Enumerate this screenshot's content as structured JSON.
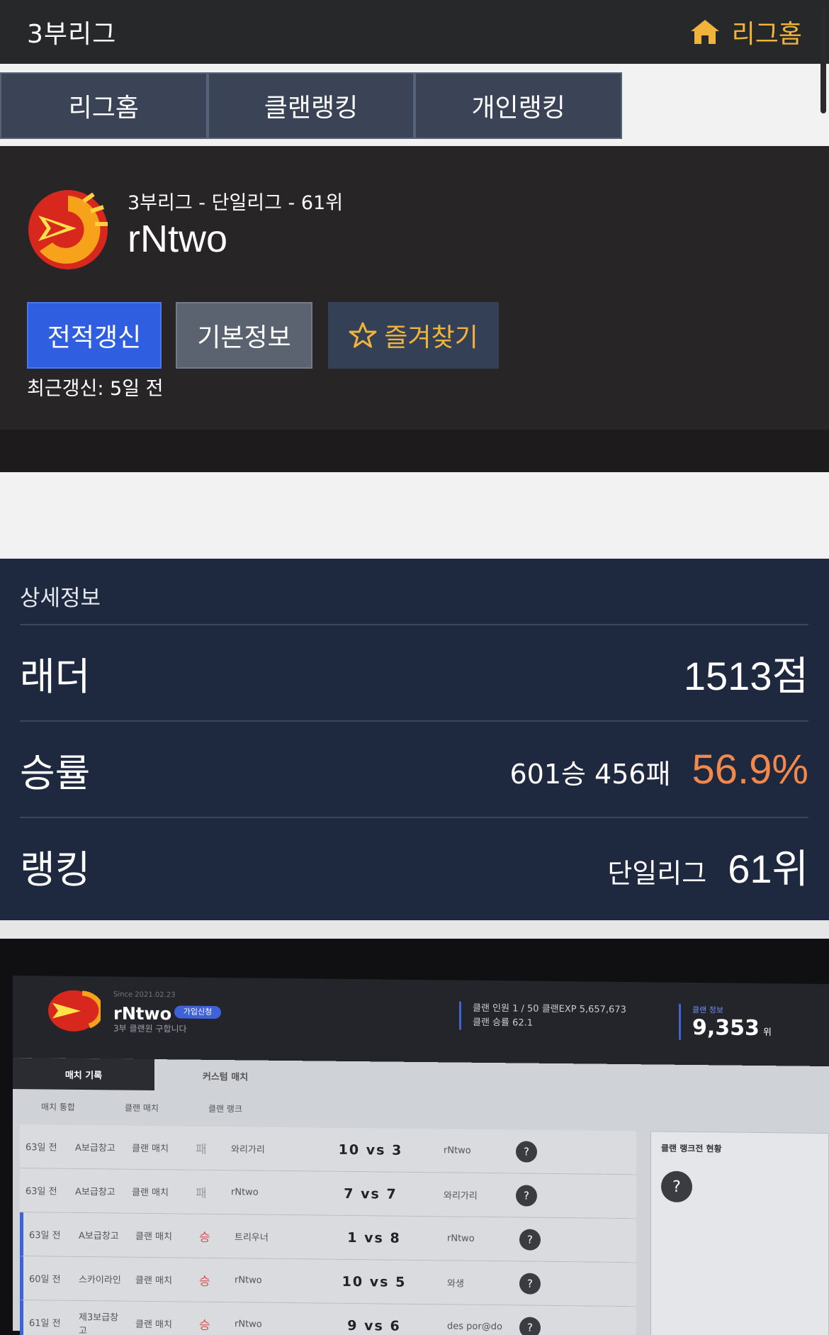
{
  "topbar": {
    "title": "3부리그",
    "home_label": "리그홈",
    "home_icon": "home-icon",
    "accent": "#f0b43a"
  },
  "tabs": [
    {
      "label": "리그홈"
    },
    {
      "label": "클랜랭킹"
    },
    {
      "label": "개인랭킹"
    }
  ],
  "profile": {
    "breadcrumb": "3부리그 - 단일리그 - 61위",
    "name": "rNtwo",
    "update_button": "전적갱신",
    "info_button": "기본정보",
    "favorite_button": "즐겨찾기",
    "favorite_icon": "star-icon",
    "last_updated": "최근갱신: 5일 전"
  },
  "detail": {
    "heading": "상세정보",
    "ladder": {
      "label": "래더",
      "value": "1513점"
    },
    "winrate": {
      "label": "승률",
      "record": "601승 456패",
      "percent": "56.9%",
      "percent_color": "#f2894a"
    },
    "ranking": {
      "label": "랭킹",
      "league": "단일리그",
      "rank": "61위"
    }
  },
  "photo": {
    "clan_name": "rNtwo",
    "badge": "가입신청",
    "subtitle": "3부 클랜원 구합니다",
    "since": "Since 2021.02.23",
    "stats_line1": "클랜 인원 1 / 50   클랜EXP 5,657,673",
    "stats_line2": "클랜 승률 62.1",
    "rank_label": "클랜 정보",
    "rank_value": "9,353",
    "rank_unit": "위",
    "tab_match": "매치 기록",
    "tab_custom": "커스텀 매치",
    "subtabs": [
      "매치 통합",
      "클랜 매치",
      "클랜 랭크"
    ],
    "side_title": "클랜 랭크전 현황",
    "matches": [
      {
        "date": "63일 전",
        "map": "A보급창고",
        "type": "클랜 매치",
        "result": "패",
        "team_a": "와리가리",
        "score_a": "10",
        "vs": "vs",
        "score_b": "3",
        "team_b": "rNtwo"
      },
      {
        "date": "63일 전",
        "map": "A보급창고",
        "type": "클랜 매치",
        "result": "패",
        "team_a": "rNtwo",
        "score_a": "7",
        "vs": "vs",
        "score_b": "7",
        "team_b": "와리가리"
      },
      {
        "date": "63일 전",
        "map": "A보급창고",
        "type": "클랜 매치",
        "result": "승",
        "team_a": "트리우너",
        "score_a": "1",
        "vs": "vs",
        "score_b": "8",
        "team_b": "rNtwo"
      },
      {
        "date": "60일 전",
        "map": "스카이라인",
        "type": "클랜 매치",
        "result": "승",
        "team_a": "rNtwo",
        "score_a": "10",
        "vs": "vs",
        "score_b": "5",
        "team_b": "와생"
      },
      {
        "date": "61일 전",
        "map": "제3보급창고",
        "type": "클랜 매치",
        "result": "승",
        "team_a": "rNtwo",
        "score_a": "9",
        "vs": "vs",
        "score_b": "6",
        "team_b": "des por@do"
      }
    ]
  }
}
